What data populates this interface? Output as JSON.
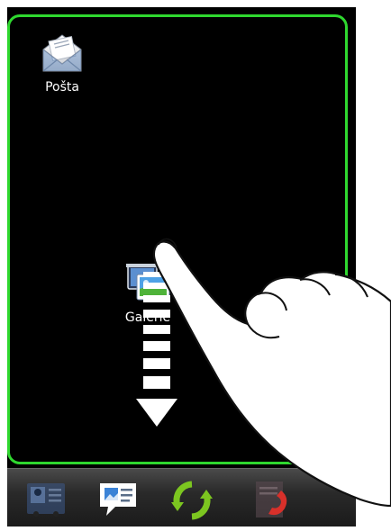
{
  "home": {
    "apps": [
      {
        "label": "Pošta",
        "icon": "mail-envelope-icon"
      },
      {
        "label": "Galerie",
        "icon": "gallery-icon"
      }
    ]
  },
  "dock": {
    "items": [
      {
        "icon": "contacts-icon"
      },
      {
        "icon": "messages-icon"
      },
      {
        "icon": "sync-icon"
      },
      {
        "icon": "phone-icon"
      }
    ]
  },
  "overlay": {
    "gesture": "drag-down-arrow-icon",
    "hand": "pointing-hand-icon"
  },
  "colors": {
    "panel_border": "#2fd82f",
    "screen_background": "#000000",
    "sync_icon": "#7cc620",
    "phone_handset": "#d8302a"
  }
}
